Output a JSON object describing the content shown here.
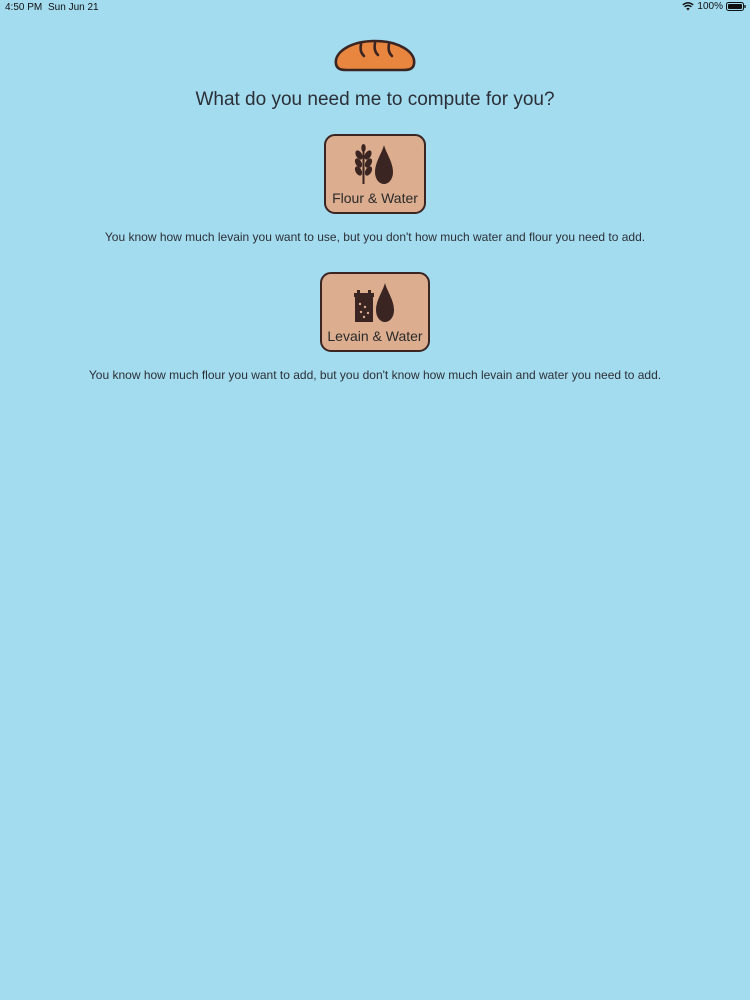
{
  "status_bar": {
    "time": "4:50 PM",
    "date": "Sun Jun 21",
    "battery_text": "100%",
    "icons": [
      "wifi-icon",
      "battery-icon"
    ]
  },
  "header": {
    "logo_icon": "bread-icon",
    "title": "What do you need me to compute for you?"
  },
  "options": [
    {
      "label": "Flour & Water",
      "icon": "wheat-and-water-drop-icon",
      "description": "You know how much levain you want to use, but you don't how much water and flour you need to add."
    },
    {
      "label": "Levain & Water",
      "icon": "jar-and-water-drop-icon",
      "description": "You know how much flour you want to add, but you don't know how much levain and water you need to add."
    }
  ],
  "colors": {
    "background": "#a3dbef",
    "button_fill": "#dcae8f",
    "button_border": "#3b2522",
    "icon_color": "#3b2522",
    "bread_fill": "#e8853f"
  }
}
